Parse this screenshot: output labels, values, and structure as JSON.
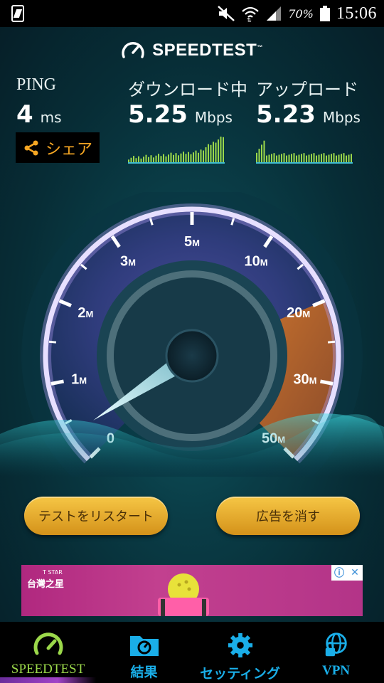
{
  "status_bar": {
    "battery_percent": "70%",
    "time": "15:06"
  },
  "app": {
    "brand": "SPEEDTEST",
    "brand_tm": "™"
  },
  "metrics": {
    "ping": {
      "label": "PING",
      "value": "4",
      "unit": "ms"
    },
    "download": {
      "label": "ダウンロード中",
      "value": "5.25",
      "unit": "Mbps",
      "color": "#9bd84a"
    },
    "upload": {
      "label": "アップロード",
      "value": "5.23",
      "unit": "Mbps",
      "color": "#9bd84a"
    }
  },
  "share": {
    "label": "シェア",
    "color": "#f5a623"
  },
  "gauge": {
    "ticks": [
      {
        "label": "0",
        "unit": ""
      },
      {
        "label": "1",
        "unit": "M"
      },
      {
        "label": "2",
        "unit": "M"
      },
      {
        "label": "3",
        "unit": "M"
      },
      {
        "label": "5",
        "unit": "M"
      },
      {
        "label": "10",
        "unit": "M"
      },
      {
        "label": "20",
        "unit": "M"
      },
      {
        "label": "30",
        "unit": "M"
      },
      {
        "label": "50",
        "unit": "M"
      }
    ],
    "current_mbps": 5.25
  },
  "buttons": {
    "restart": "テストをリスタート",
    "remove_ads": "広告を消す"
  },
  "ad": {
    "brand_small": "T STAR",
    "brand": "台灣之星",
    "info_icon": "info-icon",
    "close_icon": "close-icon"
  },
  "nav": [
    {
      "label": "SPEEDTEST",
      "icon": "speedometer-icon",
      "active": true
    },
    {
      "label": "結果",
      "icon": "results-folder-icon",
      "active": false
    },
    {
      "label": "セッティング",
      "icon": "gear-icon",
      "active": false
    },
    {
      "label": "VPN",
      "icon": "vpn-lock-globe-icon",
      "active": false
    }
  ],
  "colors": {
    "accent_orange": "#f5a623",
    "nav_blue": "#1aaee8",
    "active_green": "#9bd84a",
    "gauge_purple": "#6a5acd"
  }
}
